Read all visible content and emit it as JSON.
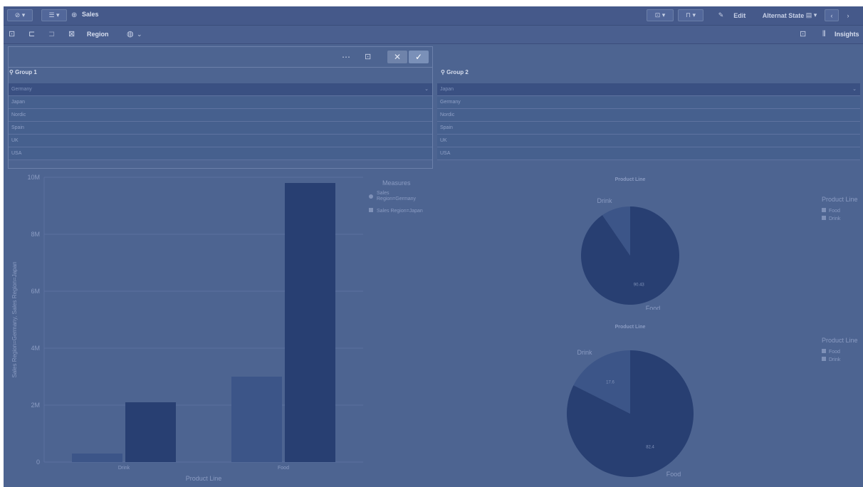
{
  "toolbar": {
    "app_title": "Sales",
    "edit_label": "Edit",
    "alt_state_label": "Alternat State",
    "insights_label": "Insights"
  },
  "subbar": {
    "field_label": "Region"
  },
  "selection": {
    "group1": {
      "label": "Group 1",
      "items": [
        "Germany",
        "Japan",
        "Nordic",
        "Spain",
        "UK",
        "USA"
      ],
      "selected": "Germany"
    },
    "group2": {
      "label": "Group 2",
      "items": [
        "Japan",
        "Germany",
        "Nordic",
        "Spain",
        "UK",
        "USA"
      ],
      "selected": "Japan"
    }
  },
  "chart_data": [
    {
      "type": "bar",
      "categories": [
        "Drink",
        "Food"
      ],
      "series": [
        {
          "name": "Sales Region=Germany",
          "values": [
            0.3,
            3.0
          ],
          "color": "#3c5588"
        },
        {
          "name": "Sales Region=Japan",
          "values": [
            2.1,
            9.8
          ],
          "color": "#283f72"
        }
      ],
      "xlabel": "Product Line",
      "ylabel": "Sales Region=Germany, Sales Region=Japan",
      "ylim": [
        0,
        10
      ],
      "yticks": [
        "0",
        "2M",
        "4M",
        "6M",
        "8M",
        "10M"
      ],
      "legend_title": "Measures",
      "legend_labels": [
        "Sales Region=Germany",
        "Sales Region=Japan"
      ],
      "legend_position": "right",
      "grid": true
    },
    {
      "type": "pie",
      "title": "Product Line",
      "categories": [
        "Food",
        "Drink"
      ],
      "values": [
        90.43,
        9.57
      ],
      "data_labels": [
        "90.43",
        ""
      ],
      "colors": [
        "#283f72",
        "#3c5588"
      ],
      "legend_title": "Product Line",
      "legend_position": "right"
    },
    {
      "type": "pie",
      "title": "Product Line",
      "categories": [
        "Food",
        "Drink"
      ],
      "values": [
        82.4,
        17.6
      ],
      "data_labels": [
        "82.4",
        "17.6"
      ],
      "colors": [
        "#283f72",
        "#3c5588"
      ],
      "legend_title": "Product Line",
      "legend_position": "right"
    }
  ]
}
